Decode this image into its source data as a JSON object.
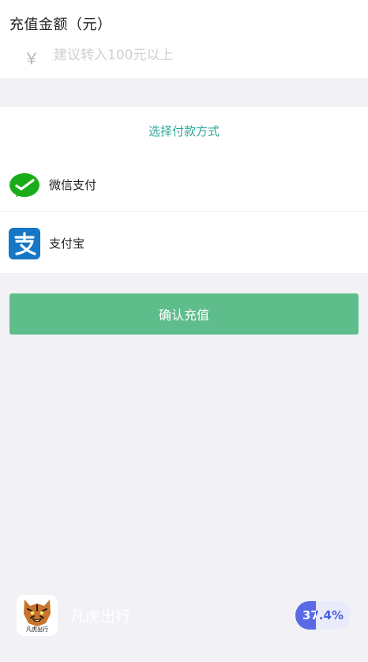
{
  "recharge": {
    "title": "充值金额（元）",
    "currency_symbol": "￥",
    "amount_value": "",
    "amount_placeholder": "建议转入100元以上"
  },
  "payment": {
    "title": "选择付款方式",
    "methods": [
      {
        "label": "微信支付",
        "icon": "wechat-pay-icon",
        "color": "#1aad19"
      },
      {
        "label": "支付宝",
        "icon": "alipay-icon",
        "color": "#1677c6"
      }
    ]
  },
  "confirm_button": {
    "label": "确认充值",
    "color": "#5fbd8c"
  },
  "footer": {
    "app_name": "凡虎出行",
    "logo_caption": "凡虎出行",
    "logo_icon": "tiger-logo-icon",
    "progress_text": "37.4%",
    "progress_fraction": 0.374,
    "progress_color": "#5a69e6"
  },
  "theme": {
    "accent": "#2fa99a",
    "background": "#f2f1f6"
  }
}
